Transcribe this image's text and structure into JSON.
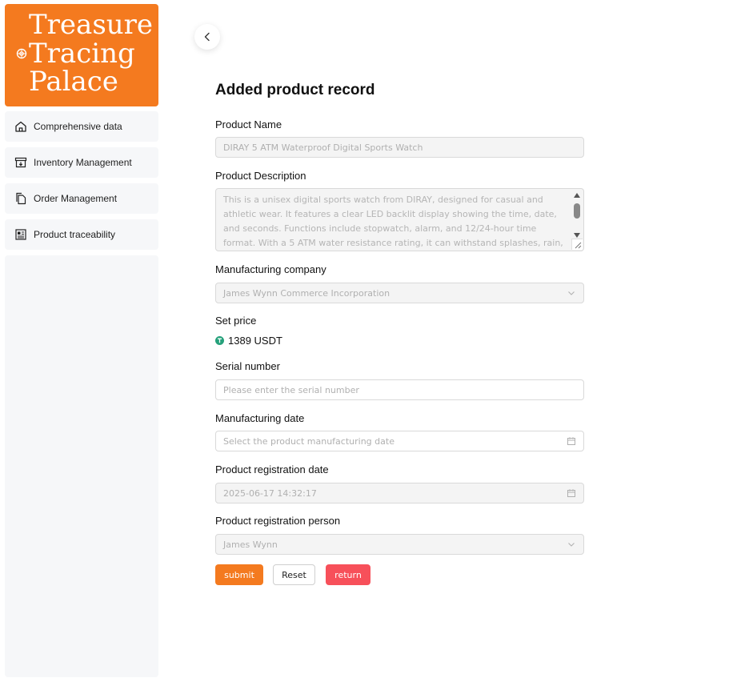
{
  "logo": {
    "line1": "Treasure",
    "line2": "Tracing",
    "line3": "Palace"
  },
  "sidebar": {
    "items": [
      {
        "label": "Comprehensive data",
        "icon": "home-icon"
      },
      {
        "label": "Inventory Management",
        "icon": "inventory-box-icon"
      },
      {
        "label": "Order Management",
        "icon": "documents-icon"
      },
      {
        "label": "Product traceability",
        "icon": "news-icon"
      }
    ]
  },
  "page": {
    "title": "Added product record"
  },
  "form": {
    "product_name": {
      "label": "Product Name",
      "value": "DIRAY 5 ATM Waterproof Digital Sports Watch"
    },
    "product_description": {
      "label": "Product Description",
      "value": "This is a unisex digital sports watch from DIRAY, designed for casual and athletic wear. It features a clear LED backlit display showing the time, date, and seconds. Functions include stopwatch, alarm, and 12/24-hour time format. With a 5 ATM water resistance rating, it can withstand splashes, rain, and brief immersion in water but is not suitable"
    },
    "manufacturing_company": {
      "label": "Manufacturing company",
      "value": "James Wynn Commerce Incorporation"
    },
    "set_price": {
      "label": "Set price",
      "value": "1389 USDT"
    },
    "serial_number": {
      "label": "Serial number",
      "placeholder": "Please enter the serial number"
    },
    "manufacturing_date": {
      "label": "Manufacturing date",
      "placeholder": "Select the product manufacturing date"
    },
    "registration_date": {
      "label": "Product registration date",
      "value": "2025-06-17 14:32:17"
    },
    "registration_person": {
      "label": "Product registration person",
      "value": "James Wynn"
    }
  },
  "buttons": {
    "submit": "submit",
    "reset": "Reset",
    "return": "return"
  },
  "colors": {
    "brand_orange": "#f47a1f",
    "danger_red": "#f7505a",
    "usdt_green": "#26a17b"
  }
}
